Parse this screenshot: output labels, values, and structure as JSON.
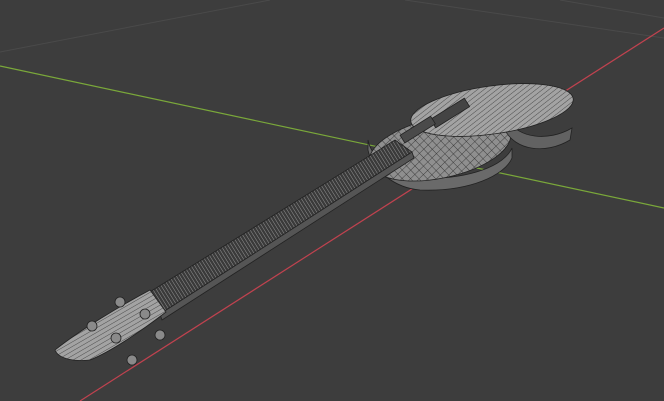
{
  "viewport": {
    "background_color": "#3d3d3d",
    "grid_color": "#4a4a4a",
    "x_axis_color": "#c0424f",
    "y_axis_color": "#7aa83a",
    "mesh_fill_color": "#9a9a9a",
    "mesh_shadow_color": "#5a5a5a",
    "wire_color": "#222222",
    "object": "guitar-wireframe-mesh"
  }
}
